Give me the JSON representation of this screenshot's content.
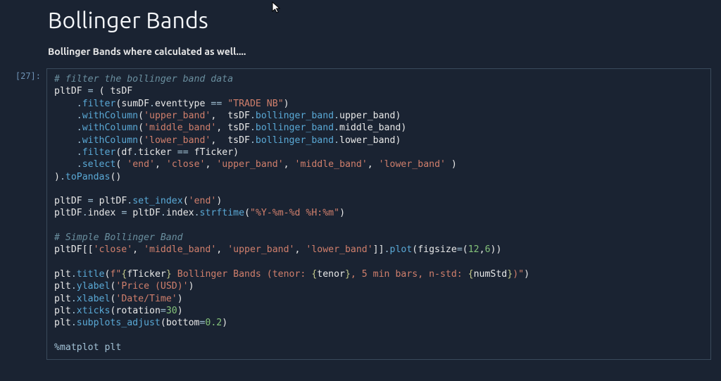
{
  "heading": "Bollinger Bands",
  "markdown_text": "Bollinger Bands where calculated as well....",
  "prompt_label": "[27]:",
  "code": {
    "c1": "# filter the bollinger band data",
    "v_pltDF": "pltDF",
    "v_tsDF": "tsDF",
    "v_sumDF": "sumDF",
    "v_df": "df",
    "v_plt": "plt",
    "v_fTicker": "fTicker",
    "v_tenor": "tenor",
    "v_numStd": "numStd",
    "m_filter": "filter",
    "m_withColumn": "withColumn",
    "m_select": "select",
    "m_toPandas": "toPandas",
    "m_set_index": "set_index",
    "m_strftime": "strftime",
    "m_plot": "plot",
    "m_title": "title",
    "m_ylabel": "ylabel",
    "m_xlabel": "xlabel",
    "m_xticks": "xticks",
    "m_subplots_adjust": "subplots_adjust",
    "attr_eventtype": "eventtype",
    "attr_bollinger_band": "bollinger_band",
    "attr_upper_band": "upper_band",
    "attr_middle_band": "middle_band",
    "attr_lower_band": "lower_band",
    "attr_ticker": "ticker",
    "attr_index": "index",
    "s_trade_nb": "\"TRADE NB\"",
    "s_upper_band": "'upper_band'",
    "s_middle_band": "'middle_band'",
    "s_lower_band": "'lower_band'",
    "s_end": "'end'",
    "s_close": "'close'",
    "s_fmt": "\"%Y-%m-%d %H:%m\"",
    "c2": "# Simple Bollinger Band",
    "kw_figsize": "figsize",
    "kw_rotation": "rotation",
    "kw_bottom": "bottom",
    "n_12": "12",
    "n_6": "6",
    "n_30": "30",
    "n_02": "0.2",
    "s_title_pre": " Bollinger Bands (tenor: ",
    "s_title_mid": ", 5 min bars, n-std: ",
    "s_title_post": ")",
    "s_price": "'Price (USD)'",
    "s_datetime": "'Date/Time'",
    "magic": "matplot plt"
  }
}
